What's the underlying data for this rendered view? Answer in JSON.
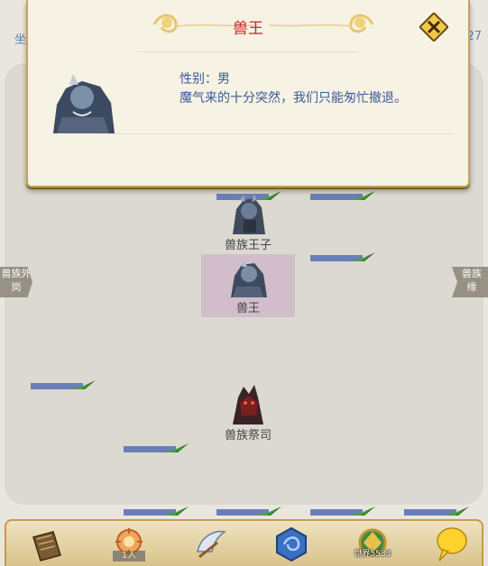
{
  "header": {
    "left_text": "坐",
    "right_text": "27"
  },
  "dialog": {
    "title": "兽王",
    "gender_line": "性别：男",
    "description": "魔气来的十分突然，我们只能匆忙撤退。"
  },
  "map": {
    "left_exit_label": "兽族外\n岗",
    "right_exit_label": "兽族\n缘",
    "npcs": [
      {
        "label": "兽族王子"
      },
      {
        "label": "兽王"
      },
      {
        "label": "兽族祭司"
      }
    ]
  },
  "bottom_bar": {
    "items": [
      {
        "icon": "scroll-icon"
      },
      {
        "icon": "team-icon",
        "badge": "1人"
      },
      {
        "icon": "wing-skill-icon"
      },
      {
        "icon": "blue-orb-icon"
      },
      {
        "icon": "emblem-icon",
        "badge": "世界5533"
      },
      {
        "icon": "chat-bubble-icon"
      }
    ]
  },
  "colors": {
    "title": "#cc2424",
    "info_text": "#3a5a9a",
    "dialog_bg": "#f6f2e4",
    "frame_gold": "#c3a25b"
  }
}
